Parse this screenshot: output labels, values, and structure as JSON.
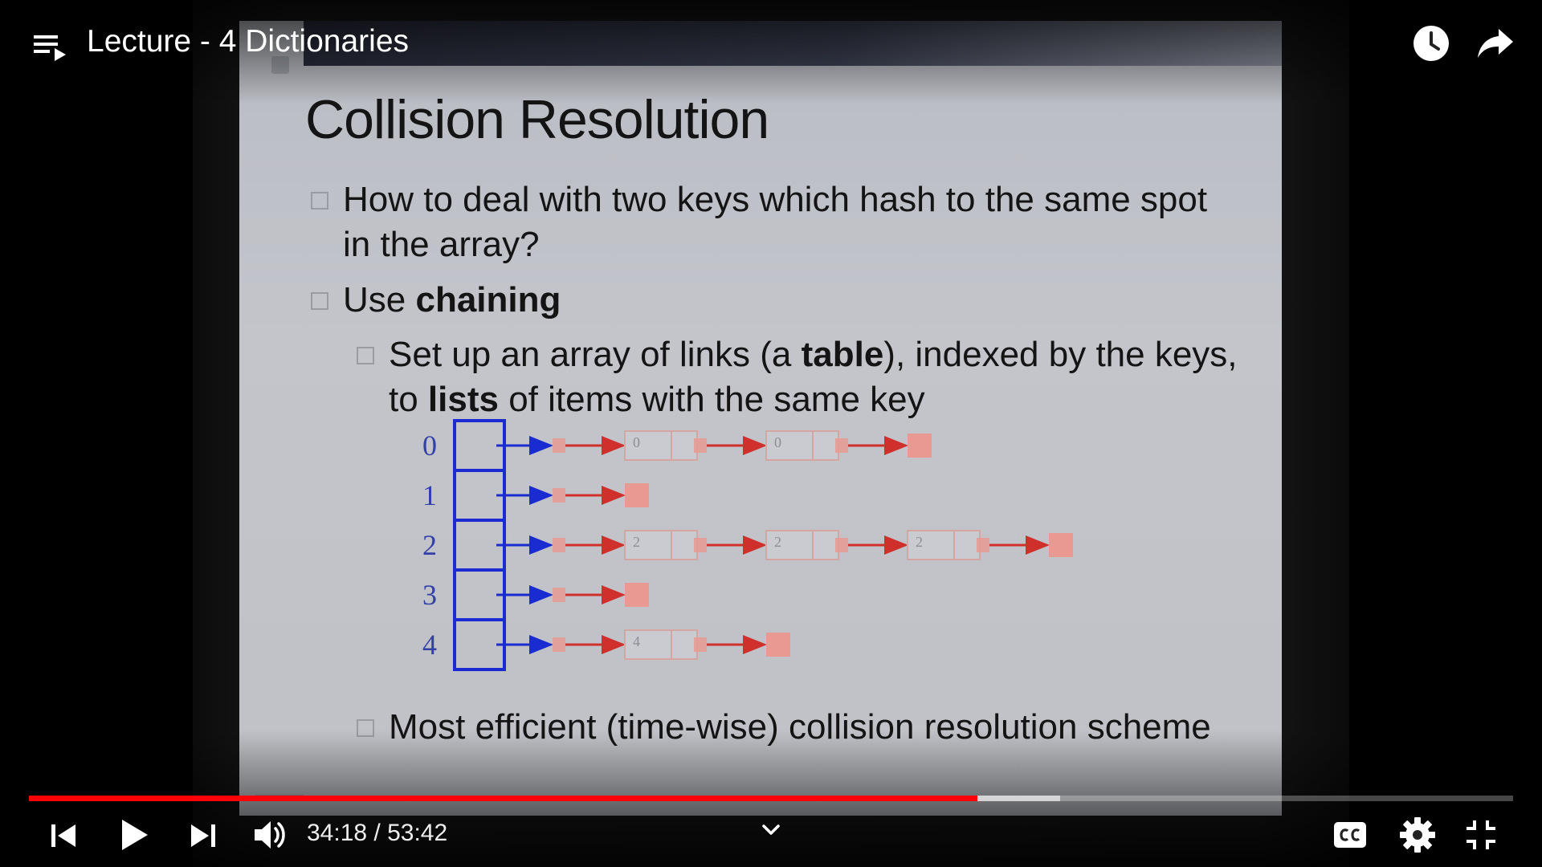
{
  "player": {
    "title": "Lecture - 4 Dictionaries",
    "time_display": "34:18 / 53:42",
    "current_time": "34:18",
    "duration": "53:42",
    "progress_played": 0.639,
    "progress_buffered": 0.695,
    "colors": {
      "played": "#ff0000",
      "accent": "#ffffff"
    },
    "icons": {
      "playlist": "playlist-icon",
      "watch_later": "clock-icon",
      "share": "share-arrow-icon",
      "previous": "skip-previous-icon",
      "play": "play-icon",
      "next": "skip-next-icon",
      "volume": "volume-icon",
      "chevron": "chevron-down-icon",
      "captions": "cc-icon",
      "settings": "gear-icon",
      "exit_fullscreen": "exit-fullscreen-icon"
    }
  },
  "slide": {
    "title": "Collision Resolution",
    "bullet1": "How to deal with two keys which hash to the same spot in the array?",
    "bullet2_prefix": "Use ",
    "bullet2_bold": "chaining",
    "bullet3_part1": "Set up an array of links (a ",
    "bullet3_bold1": "table",
    "bullet3_part2": "), indexed by the keys, to ",
    "bullet3_bold2": "lists",
    "bullet3_part3": " of items with the same key",
    "bullet4": "Most efficient (time-wise) collision resolution scheme",
    "table_indices": [
      "0",
      "1",
      "2",
      "3",
      "4"
    ],
    "chain_node_labels": [
      [
        "0",
        "0"
      ],
      [],
      [
        "2",
        "2",
        "2"
      ],
      [],
      [
        "4"
      ]
    ]
  }
}
